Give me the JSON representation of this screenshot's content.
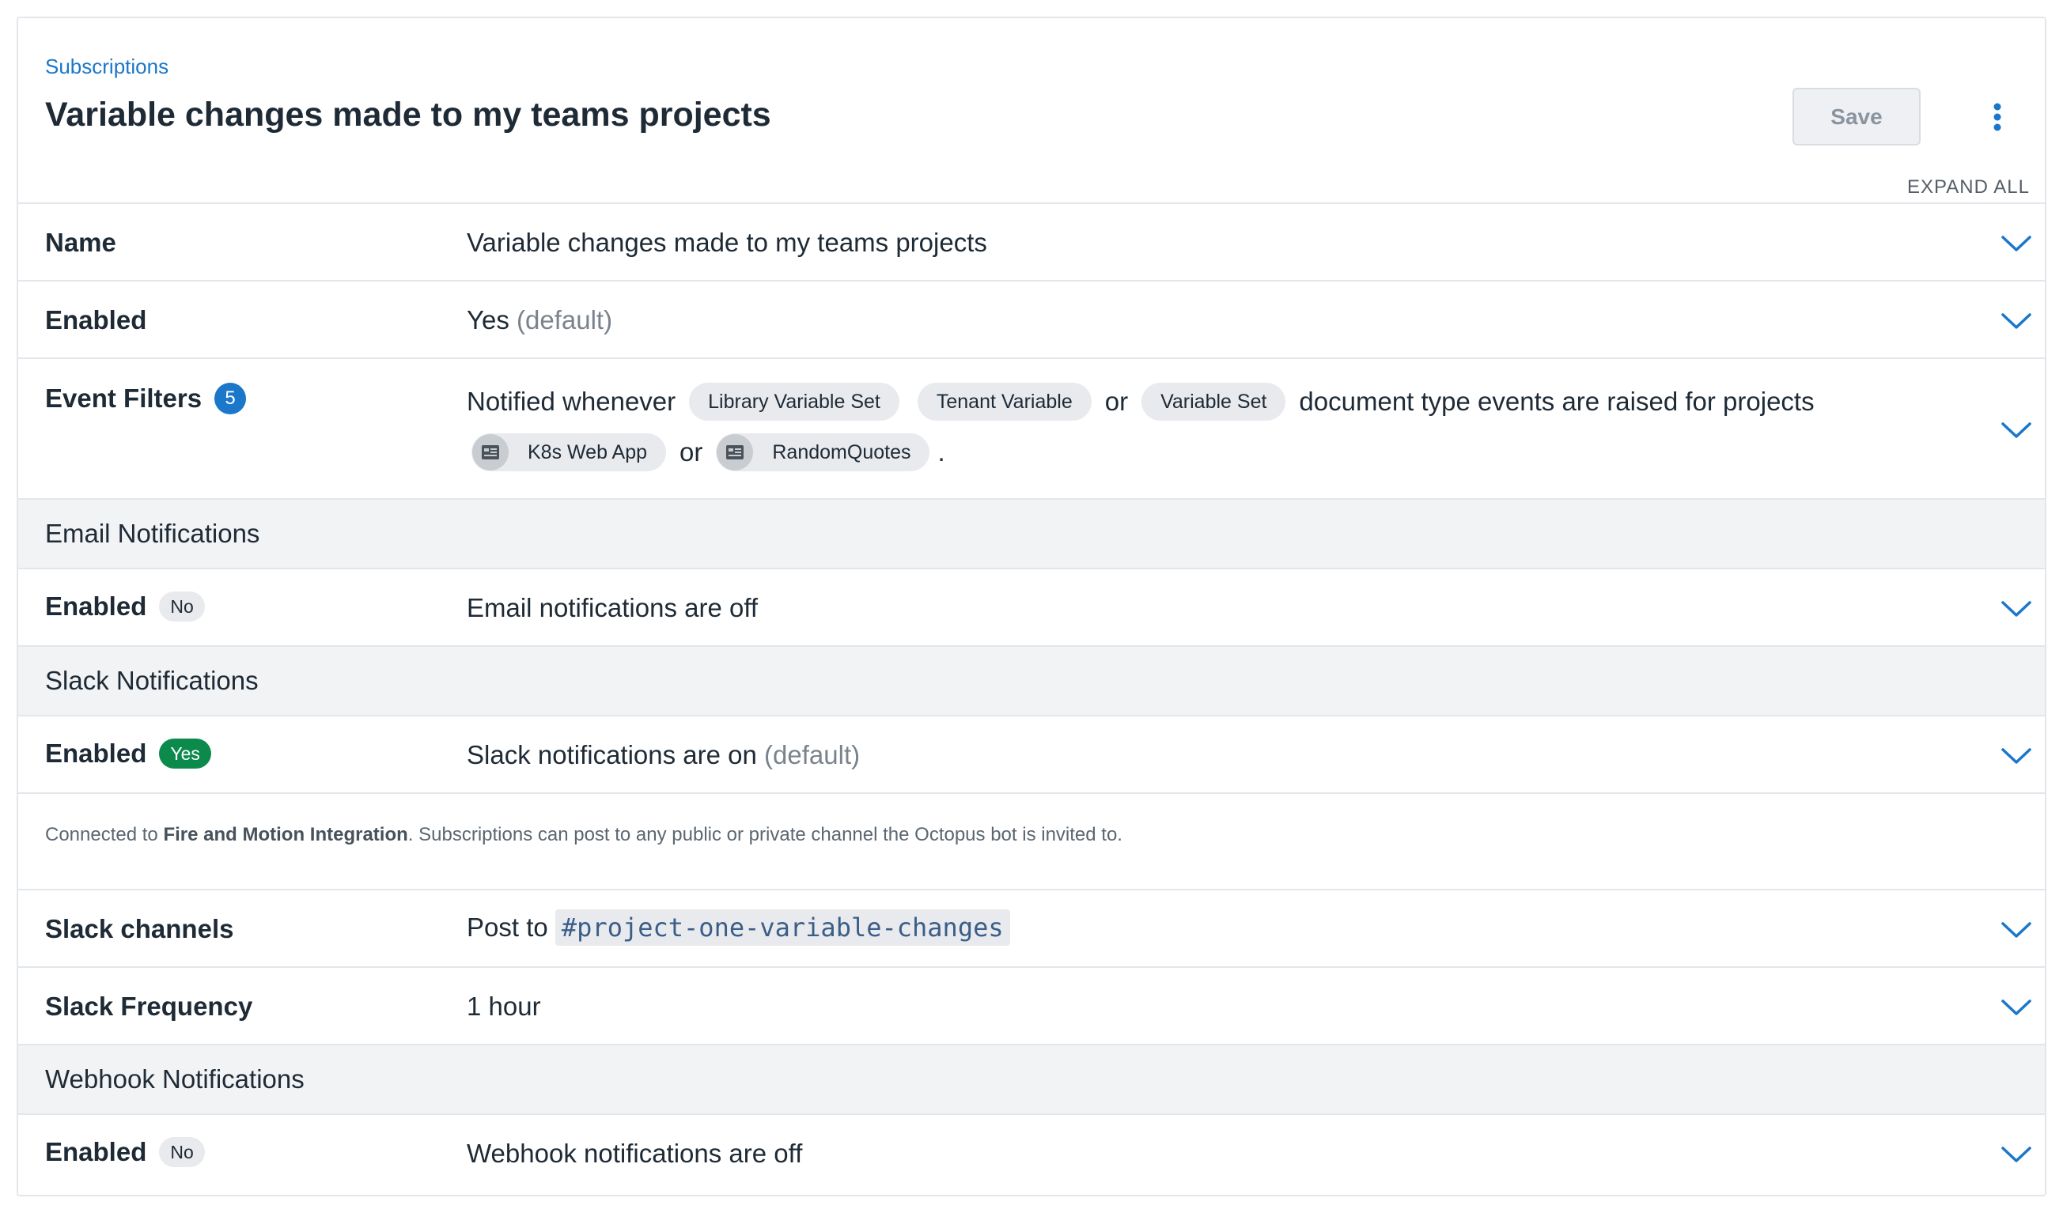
{
  "breadcrumb": "Subscriptions",
  "title": "Variable changes made to my teams projects",
  "toolbar": {
    "save_label": "Save",
    "more_icon": "vertical-ellipsis-icon"
  },
  "expand_all": "EXPAND ALL",
  "colors": {
    "accent": "#1a77ca",
    "success": "#0b8a4c",
    "muted_text": "#7a838c",
    "section_bg": "#f1f3f5"
  },
  "name_row": {
    "label": "Name",
    "value": "Variable changes made to my teams projects"
  },
  "enabled_row": {
    "label": "Enabled",
    "value": "Yes",
    "suffix": "(default)"
  },
  "event_filters": {
    "label": "Event Filters",
    "count": "5",
    "prefix": "Notified whenever",
    "doc_types": [
      "Library Variable Set",
      "Tenant Variable",
      "Variable Set"
    ],
    "or": "or",
    "middle": "document type events are raised for projects",
    "projects": [
      "K8s Web App",
      "RandomQuotes"
    ],
    "end": "."
  },
  "email": {
    "section": "Email Notifications",
    "label": "Enabled",
    "badge": "No",
    "value": "Email notifications are off"
  },
  "slack": {
    "section": "Slack Notifications",
    "label": "Enabled",
    "badge": "Yes",
    "value": "Slack notifications are on",
    "suffix": "(default)",
    "info_prefix": "Connected to",
    "info_integration": "Fire and Motion Integration",
    "info_suffix": ". Subscriptions can post to any public or private channel the Octopus bot is invited to.",
    "channels_label": "Slack channels",
    "channels_prefix": "Post to",
    "channel": "#project-one-variable-changes",
    "frequency_label": "Slack Frequency",
    "frequency": "1 hour"
  },
  "webhook": {
    "section": "Webhook Notifications",
    "label": "Enabled",
    "badge": "No",
    "value": "Webhook notifications are off"
  }
}
